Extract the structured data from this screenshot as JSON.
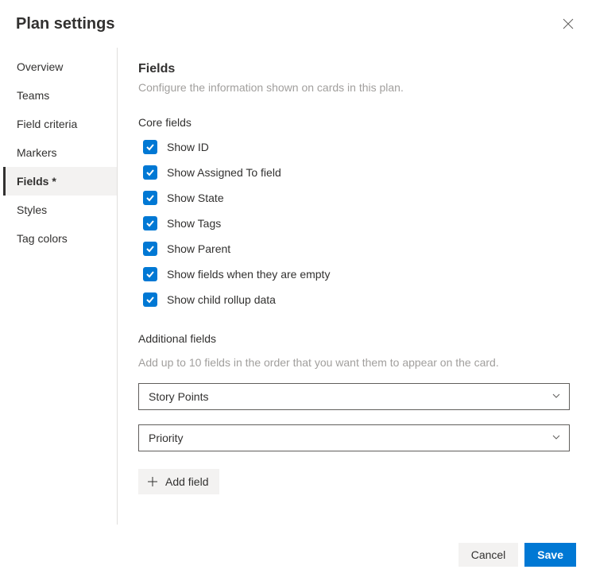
{
  "header": {
    "title": "Plan settings"
  },
  "sidebar": {
    "items": [
      {
        "label": "Overview",
        "active": false
      },
      {
        "label": "Teams",
        "active": false
      },
      {
        "label": "Field criteria",
        "active": false
      },
      {
        "label": "Markers",
        "active": false
      },
      {
        "label": "Fields *",
        "active": true
      },
      {
        "label": "Styles",
        "active": false
      },
      {
        "label": "Tag colors",
        "active": false
      }
    ]
  },
  "panel": {
    "title": "Fields",
    "description": "Configure the information shown on cards in this plan.",
    "core_heading": "Core fields",
    "core_fields": [
      {
        "label": "Show ID",
        "checked": true
      },
      {
        "label": "Show Assigned To field",
        "checked": true
      },
      {
        "label": "Show State",
        "checked": true
      },
      {
        "label": "Show Tags",
        "checked": true
      },
      {
        "label": "Show Parent",
        "checked": true
      },
      {
        "label": "Show fields when they are empty",
        "checked": true
      },
      {
        "label": "Show child rollup data",
        "checked": true
      }
    ],
    "additional_heading": "Additional fields",
    "additional_description": "Add up to 10 fields in the order that you want them to appear on the card.",
    "additional_fields": [
      {
        "value": "Story Points"
      },
      {
        "value": "Priority"
      }
    ],
    "add_field_label": "Add field"
  },
  "footer": {
    "cancel": "Cancel",
    "save": "Save"
  }
}
